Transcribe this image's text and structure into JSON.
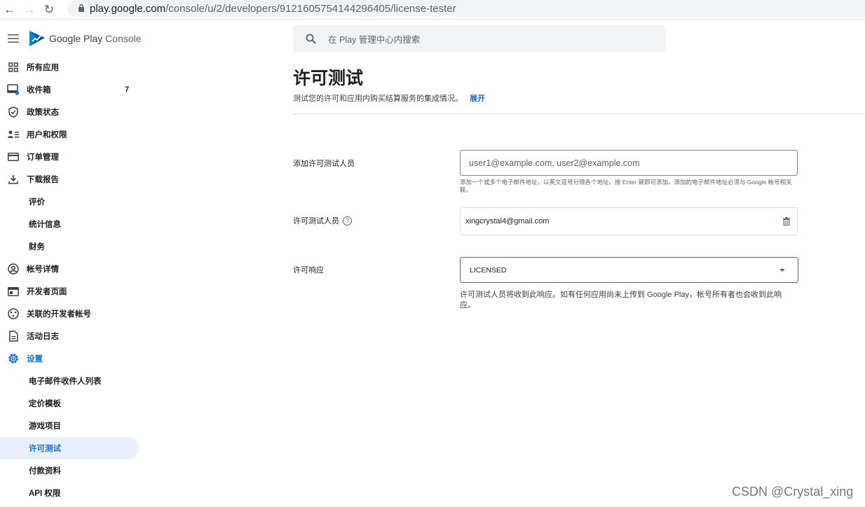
{
  "browser": {
    "url_host": "play.google.com",
    "url_path": "/console/u/2/developers/9121605754144296405/license-tester"
  },
  "brand": {
    "name_google": "Google Play",
    "name_console": " Console"
  },
  "sidebar": {
    "items": [
      {
        "label": "所有应用",
        "icon": "apps-grid-icon"
      },
      {
        "label": "收件箱",
        "icon": "inbox-icon",
        "badge": "7"
      },
      {
        "label": "政策状态",
        "icon": "shield-icon"
      },
      {
        "label": "用户和权限",
        "icon": "users-icon"
      },
      {
        "label": "订单管理",
        "icon": "credit-card-icon"
      },
      {
        "label": "下载报告",
        "icon": "download-icon"
      },
      {
        "label": "评价",
        "sub": true
      },
      {
        "label": "统计信息",
        "sub": true
      },
      {
        "label": "财务",
        "sub": true
      },
      {
        "label": "帐号详情",
        "icon": "account-icon"
      },
      {
        "label": "开发者页面",
        "icon": "web-page-icon"
      },
      {
        "label": "关联的开发者帐号",
        "icon": "linked-accounts-icon"
      },
      {
        "label": "活动日志",
        "icon": "document-icon"
      },
      {
        "label": "设置",
        "icon": "settings-gear-icon",
        "color": "#1a73e8"
      },
      {
        "label": "电子邮件收件人列表",
        "sub": true
      },
      {
        "label": "定价模板",
        "sub": true
      },
      {
        "label": "游戏项目",
        "sub": true
      },
      {
        "label": "许可测试",
        "sub": true,
        "active": true
      },
      {
        "label": "付款资料",
        "sub": true
      },
      {
        "label": "API 权限",
        "sub": true
      }
    ]
  },
  "search": {
    "placeholder": "在 Play 管理中心内搜索"
  },
  "page": {
    "title": "许可测试",
    "description": "测试您的许可和应用内购买结算服务的集成情况。",
    "expand_link": "展开"
  },
  "form": {
    "add_label": "添加许可测试人员",
    "add_placeholder": "user1@example.com, user2@example.com",
    "add_hint": "添加一个或多个电子邮件地址，以英文逗号分隔各个地址。按 Enter 键即可添加。添加的电子邮件地址必须与 Google 帐号相关联。",
    "testers_label": "许可测试人员",
    "testers": [
      "xingcrystal4@gmail.com"
    ],
    "response_label": "许可响应",
    "response_value": "LICENSED",
    "response_note": "许可测试人员将收到此响应。如有任何应用尚未上传到 Google Play，帐号所有者也会收到此响应。"
  },
  "watermark": "CSDN @Crystal_xing",
  "colors": {
    "accent": "#1a73e8",
    "active_bg": "#e8f0fe"
  }
}
